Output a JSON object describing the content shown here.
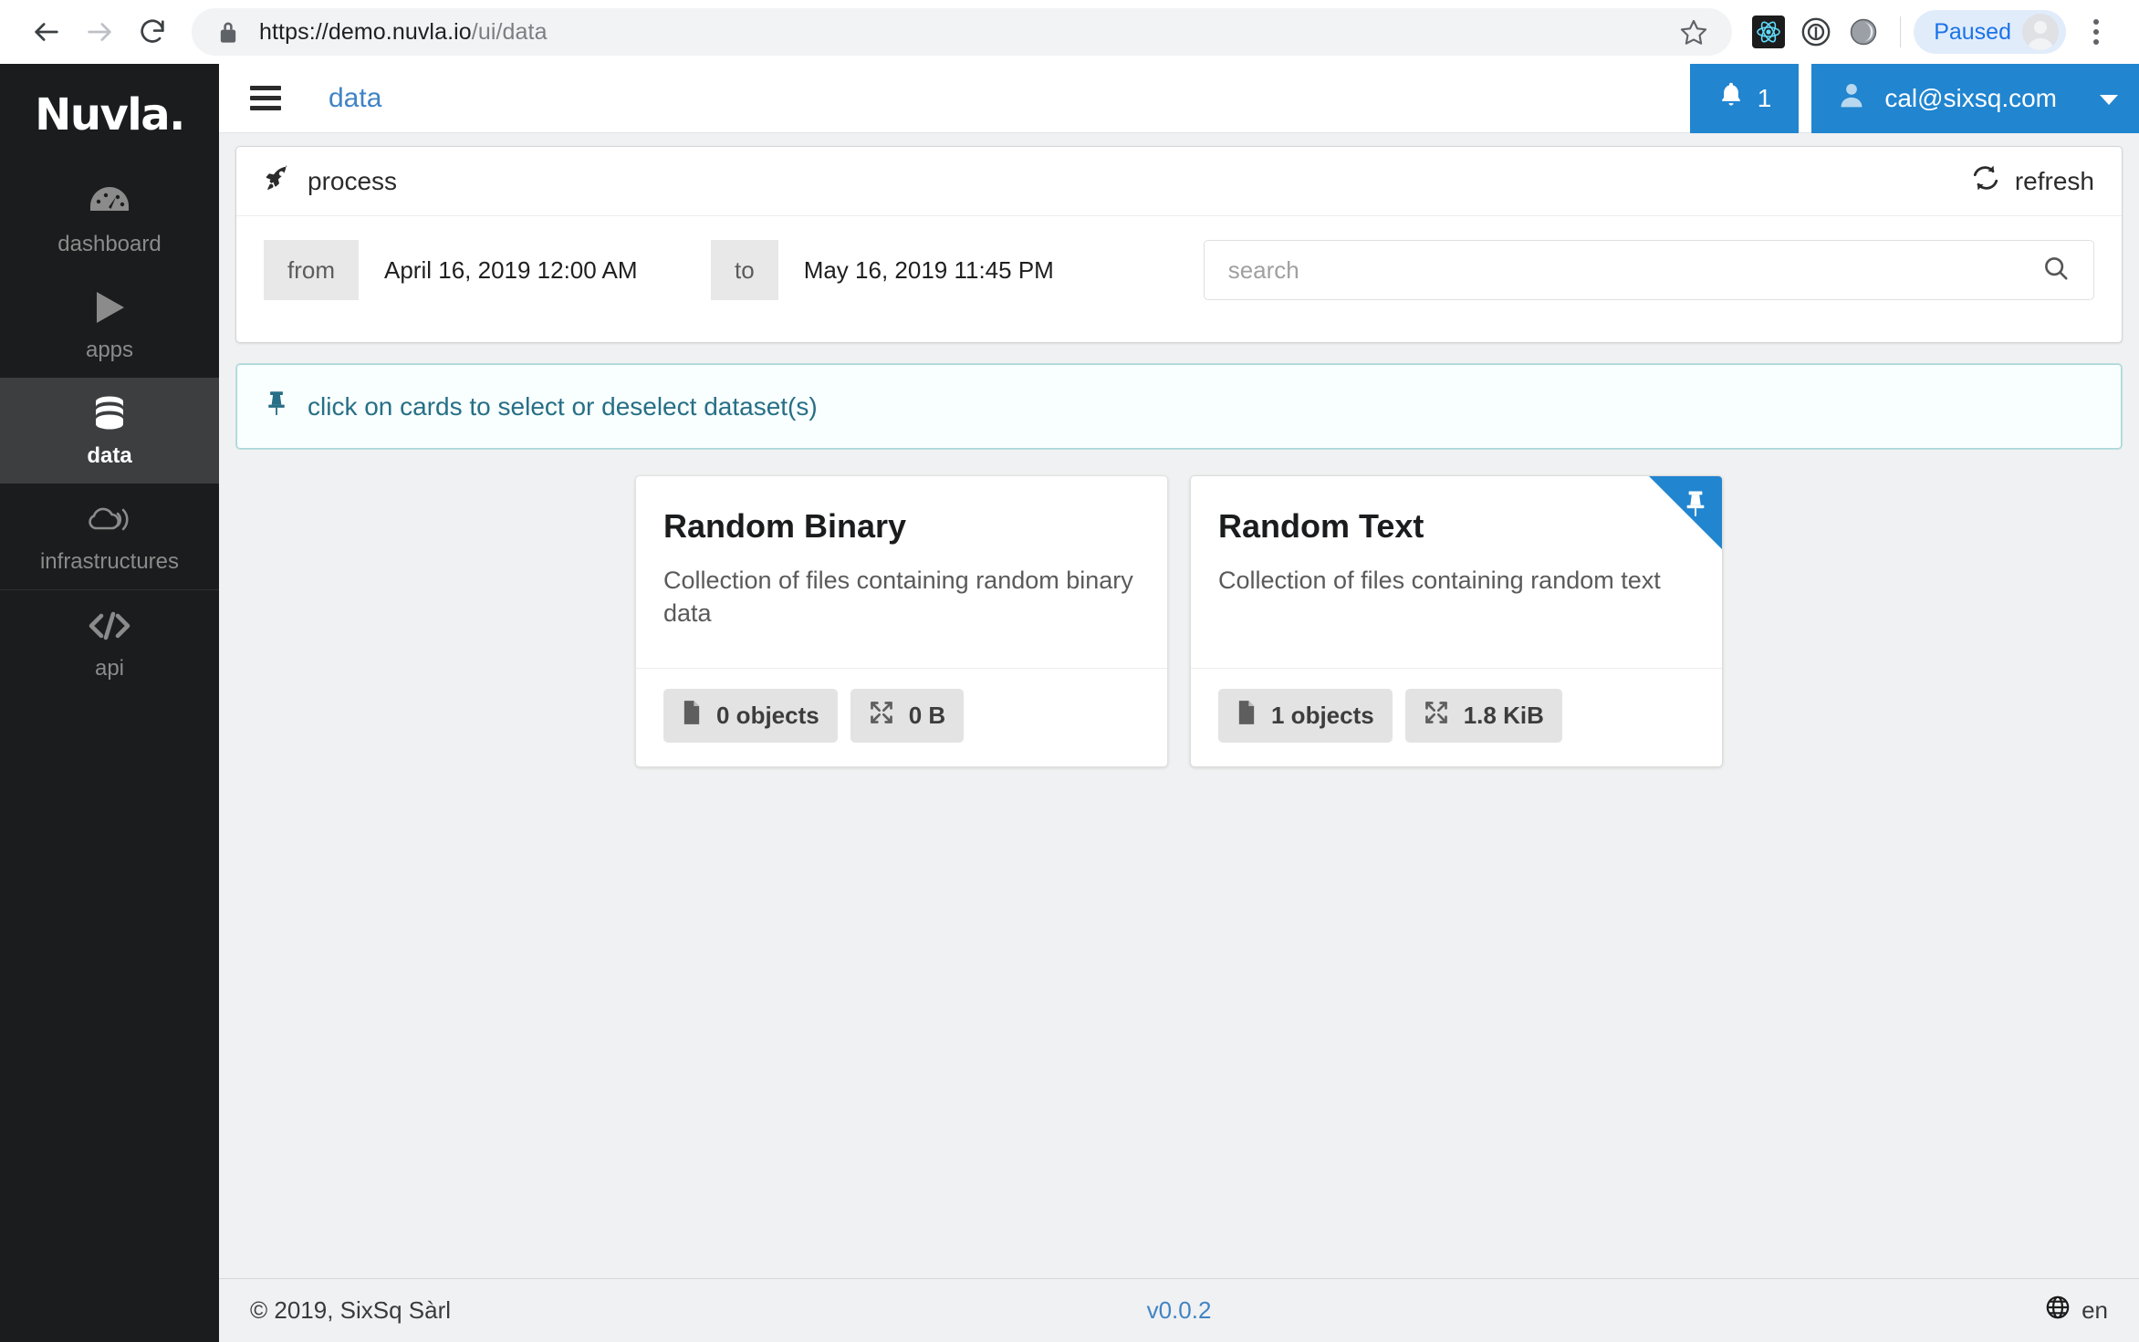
{
  "browser": {
    "back_icon": "arrow-left-icon",
    "forward_icon": "arrow-right-icon",
    "reload_icon": "reload-icon",
    "lock_icon": "lock-icon",
    "url_domain": "https://demo.nuvla.io",
    "url_path": "/ui/data",
    "star_icon": "star-icon",
    "extensions": [
      "react-devtools-icon",
      "1password-icon",
      "extension-icon"
    ],
    "profile_label": "Paused",
    "avatar_icon": "avatar-icon",
    "menu_icon": "kebab-menu-icon"
  },
  "sidebar": {
    "logo": "Nuvla.",
    "items": [
      {
        "label": "dashboard",
        "icon": "dashboard-gauge-icon",
        "active": false
      },
      {
        "label": "apps",
        "icon": "play-triangle-icon",
        "active": false
      },
      {
        "label": "data",
        "icon": "database-icon",
        "active": true
      },
      {
        "label": "infrastructures",
        "icon": "cloud-signal-icon",
        "active": false
      },
      {
        "label": "api",
        "icon": "code-brackets-icon",
        "active": false
      }
    ]
  },
  "topbar": {
    "menu_icon": "hamburger-icon",
    "breadcrumb": "data",
    "notifications_icon": "bell-icon",
    "notifications_count": "1",
    "user_icon": "user-icon",
    "user_email": "cal@sixsq.com",
    "caret_icon": "caret-down-icon"
  },
  "process_panel": {
    "icon": "rocket-icon",
    "title": "process",
    "refresh_icon": "sync-icon",
    "refresh_label": "refresh",
    "from_label": "from",
    "from_value": "April 16, 2019 12:00 AM",
    "to_label": "to",
    "to_value": "May 16, 2019 11:45 PM",
    "search_value": "",
    "search_placeholder": "search",
    "search_icon": "search-icon"
  },
  "info_message": {
    "icon": "pin-icon",
    "text": "click on cards to select or deselect dataset(s)"
  },
  "cards": [
    {
      "title": "Random Binary",
      "description": "Collection of files containing random binary data",
      "objects_icon": "file-icon",
      "objects_label": "0 objects",
      "size_icon": "expand-arrows-icon",
      "size_label": "0 B",
      "selected": false,
      "pin_icon": "pin-icon"
    },
    {
      "title": "Random Text",
      "description": "Collection of files containing random text",
      "objects_icon": "file-icon",
      "objects_label": "1 objects",
      "size_icon": "expand-arrows-icon",
      "size_label": "1.8 KiB",
      "selected": true,
      "pin_icon": "pin-icon"
    }
  ],
  "footer": {
    "copyright": "© 2019, SixSq Sàrl",
    "version": "v0.0.2",
    "globe_icon": "globe-icon",
    "language": "en"
  },
  "colors": {
    "accent_blue": "#2185d0",
    "link_blue": "#4183c4",
    "sidebar_bg": "#1b1c1d",
    "sidebar_active": "#3d3e3f",
    "info_teal": "#276f86",
    "page_bg": "#f0f1f2"
  }
}
